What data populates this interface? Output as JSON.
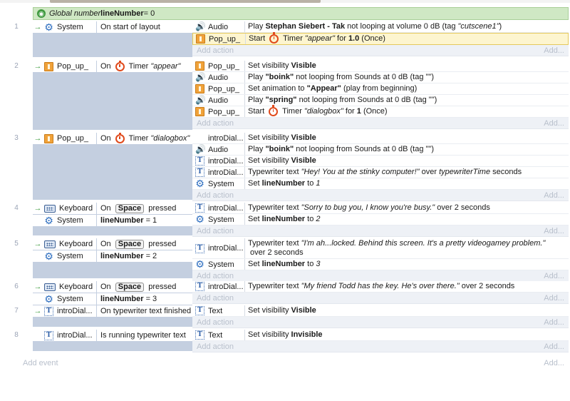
{
  "global_var": {
    "prefix": "Global number ",
    "name": "lineNumber",
    "suffix": " = 0"
  },
  "add_action": "Add action",
  "add_more": "Add...",
  "add_event": "Add event",
  "events": [
    {
      "num": "1",
      "conditions": [
        {
          "arrow": true,
          "icon": "gear-icon",
          "object": "System",
          "text": "On start of layout"
        }
      ],
      "actions": [
        {
          "icon": "audio-icon",
          "object": "Audio",
          "parts": [
            {
              "t": "Play "
            },
            {
              "b": "Stephan Siebert - Tak"
            },
            {
              "t": " not looping at volume 0 dB (tag "
            },
            {
              "i": "\"cutscene1\""
            },
            {
              "t": ")"
            }
          ]
        },
        {
          "icon": "sprite-icon",
          "object": "Pop_up_",
          "highlight": true,
          "parts": [
            {
              "t": "Start "
            },
            {
              "timer": true
            },
            {
              "t": " Timer "
            },
            {
              "i": "\"appear\""
            },
            {
              "t": " for "
            },
            {
              "b": "1.0"
            },
            {
              "t": " (Once)"
            }
          ]
        }
      ]
    },
    {
      "num": "2",
      "conditions": [
        {
          "arrow": true,
          "icon": "sprite-icon",
          "object": "Pop_up_",
          "parts": [
            {
              "t": "On "
            },
            {
              "timer": true
            },
            {
              "t": " Timer "
            },
            {
              "i": "\"appear\""
            }
          ]
        }
      ],
      "actions": [
        {
          "icon": "sprite-icon",
          "object": "Pop_up_",
          "parts": [
            {
              "t": "Set visibility "
            },
            {
              "b": "Visible"
            }
          ]
        },
        {
          "icon": "audio-icon",
          "object": "Audio",
          "parts": [
            {
              "t": "Play "
            },
            {
              "b": "\"boink\""
            },
            {
              "t": " not looping from Sounds at 0 dB (tag \"\")"
            }
          ]
        },
        {
          "icon": "sprite-icon",
          "object": "Pop_up_",
          "parts": [
            {
              "t": "Set animation to "
            },
            {
              "b": "\"Appear\""
            },
            {
              "t": " (play from beginning)"
            }
          ]
        },
        {
          "icon": "audio-icon",
          "object": "Audio",
          "parts": [
            {
              "t": "Play "
            },
            {
              "b": "\"spring\""
            },
            {
              "t": " not looping from Sounds at 0 dB (tag \"\")"
            }
          ]
        },
        {
          "icon": "sprite-icon",
          "object": "Pop_up_",
          "parts": [
            {
              "t": "Start "
            },
            {
              "timer": true
            },
            {
              "t": " Timer "
            },
            {
              "i": "\"dialogbox\""
            },
            {
              "t": " for "
            },
            {
              "b": "1"
            },
            {
              "t": " (Once)"
            }
          ]
        }
      ]
    },
    {
      "num": "3",
      "conditions": [
        {
          "arrow": true,
          "icon": "sprite-icon",
          "object": "Pop_up_",
          "parts": [
            {
              "t": "On "
            },
            {
              "timer": true
            },
            {
              "t": " Timer "
            },
            {
              "i": "\"dialogbox\""
            }
          ]
        }
      ],
      "actions": [
        {
          "icon": "",
          "object": "introDial...",
          "parts": [
            {
              "t": "Set visibility "
            },
            {
              "b": "Visible"
            }
          ]
        },
        {
          "icon": "audio-icon",
          "object": "Audio",
          "parts": [
            {
              "t": "Play "
            },
            {
              "b": "\"boink\""
            },
            {
              "t": " not looping from Sounds at 0 dB (tag \"\")"
            }
          ]
        },
        {
          "icon": "text-icon",
          "object": "introDial...",
          "parts": [
            {
              "t": "Set visibility "
            },
            {
              "b": "Visible"
            }
          ]
        },
        {
          "icon": "text-icon",
          "object": "introDial...",
          "parts": [
            {
              "t": "Typewriter text "
            },
            {
              "i": "\"Hey! You at the stinky computer!\""
            },
            {
              "t": " over "
            },
            {
              "i": "typewriterTime"
            },
            {
              "t": " seconds"
            }
          ]
        },
        {
          "icon": "gear-icon",
          "object": "System",
          "parts": [
            {
              "t": "Set "
            },
            {
              "b": "lineNumber"
            },
            {
              "t": " to "
            },
            {
              "i": "1"
            }
          ]
        }
      ]
    },
    {
      "num": "4",
      "conditions": [
        {
          "arrow": true,
          "icon": "keyboard-icon",
          "object": "Keyboard",
          "parts": [
            {
              "t": "On "
            },
            {
              "key": "Space"
            },
            {
              "t": " pressed"
            }
          ]
        },
        {
          "arrow": false,
          "icon": "gear-icon",
          "object": "System",
          "parts": [
            {
              "b": "lineNumber"
            },
            {
              "t": " = 1"
            }
          ]
        }
      ],
      "actions": [
        {
          "icon": "text-icon",
          "object": "introDial...",
          "parts": [
            {
              "t": "Typewriter text "
            },
            {
              "i": "\"Sorry to bug you, I know you're busy.\""
            },
            {
              "t": " over 2 seconds"
            }
          ]
        },
        {
          "icon": "gear-icon",
          "object": "System",
          "parts": [
            {
              "t": "Set "
            },
            {
              "b": "lineNumber"
            },
            {
              "t": " to "
            },
            {
              "i": "2"
            }
          ]
        }
      ]
    },
    {
      "num": "5",
      "conditions": [
        {
          "arrow": true,
          "icon": "keyboard-icon",
          "object": "Keyboard",
          "parts": [
            {
              "t": "On "
            },
            {
              "key": "Space"
            },
            {
              "t": " pressed"
            }
          ]
        },
        {
          "arrow": false,
          "icon": "gear-icon",
          "object": "System",
          "parts": [
            {
              "b": "lineNumber"
            },
            {
              "t": " = 2"
            }
          ]
        }
      ],
      "actions": [
        {
          "icon": "text-icon",
          "object": "introDial...",
          "parts": [
            {
              "t": "Typewriter text "
            },
            {
              "i": "\"I'm ah...locked. Behind this screen. It's a pretty videogamey problem.\""
            },
            {
              "t": " over 2 seconds"
            }
          ]
        },
        {
          "icon": "gear-icon",
          "object": "System",
          "parts": [
            {
              "t": "Set "
            },
            {
              "b": "lineNumber"
            },
            {
              "t": " to "
            },
            {
              "i": "3"
            }
          ]
        }
      ]
    },
    {
      "num": "6",
      "conditions": [
        {
          "arrow": true,
          "icon": "keyboard-icon",
          "object": "Keyboard",
          "parts": [
            {
              "t": "On "
            },
            {
              "key": "Space"
            },
            {
              "t": " pressed"
            }
          ]
        },
        {
          "arrow": false,
          "icon": "gear-icon",
          "object": "System",
          "parts": [
            {
              "b": "lineNumber"
            },
            {
              "t": " = 3"
            }
          ]
        }
      ],
      "actions": [
        {
          "icon": "text-icon",
          "object": "introDial...",
          "parts": [
            {
              "t": "Typewriter text "
            },
            {
              "i": "\"My friend Todd has the key. He's over there.\""
            },
            {
              "t": " over 2 seconds"
            }
          ]
        }
      ]
    },
    {
      "num": "7",
      "conditions": [
        {
          "arrow": true,
          "icon": "text-icon",
          "object": "introDial...",
          "text": "On typewriter text finished"
        }
      ],
      "actions": [
        {
          "icon": "text-icon",
          "object": "Text",
          "parts": [
            {
              "t": "Set visibility "
            },
            {
              "b": "Visible"
            }
          ]
        }
      ]
    },
    {
      "num": "8",
      "conditions": [
        {
          "arrow": false,
          "icon": "text-icon",
          "object": "introDial...",
          "text": "Is running typewriter text"
        }
      ],
      "actions": [
        {
          "icon": "text-icon",
          "object": "Text",
          "parts": [
            {
              "t": "Set visibility "
            },
            {
              "b": "Invisible"
            }
          ]
        }
      ]
    }
  ]
}
